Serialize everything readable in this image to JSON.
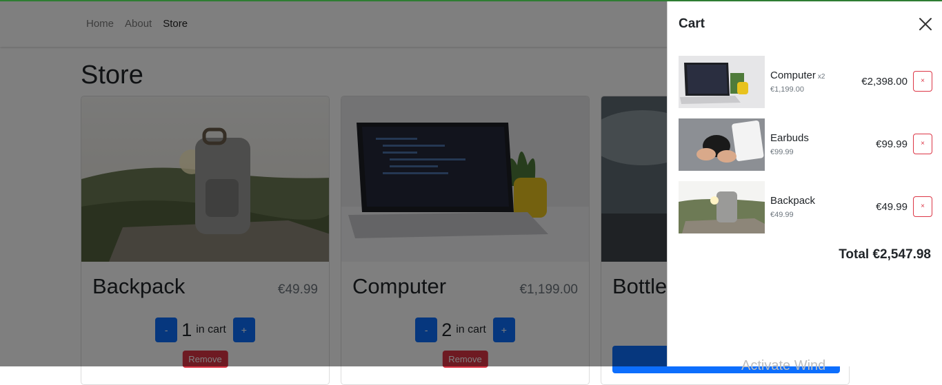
{
  "nav": {
    "items": [
      {
        "label": "Home",
        "active": false
      },
      {
        "label": "About",
        "active": false
      },
      {
        "label": "Store",
        "active": true
      }
    ]
  },
  "store": {
    "title": "Store",
    "products": [
      {
        "name": "Backpack",
        "price": "€49.99",
        "count": "1",
        "in_cart_label": "in cart",
        "minus": "-",
        "plus": "+",
        "remove_label": "Remove"
      },
      {
        "name": "Computer",
        "price": "€1,199.00",
        "count": "2",
        "in_cart_label": "in cart",
        "minus": "-",
        "plus": "+",
        "remove_label": "Remove"
      },
      {
        "name": "Bottle"
      }
    ]
  },
  "cart": {
    "title": "Cart",
    "items": [
      {
        "name": "Computer",
        "qty": "x2",
        "unit_price": "€1,199.00",
        "total": "€2,398.00",
        "remove": "×"
      },
      {
        "name": "Earbuds",
        "qty": "",
        "unit_price": "€99.99",
        "total": "€99.99",
        "remove": "×"
      },
      {
        "name": "Backpack",
        "qty": "",
        "unit_price": "€49.99",
        "total": "€49.99",
        "remove": "×"
      }
    ],
    "total_label": "Total €2,547.98"
  },
  "watermark": "Activate Wind",
  "colors": {
    "primary": "#0d6efd",
    "danger": "#dc3545",
    "accent_line": "#2e7d32"
  }
}
